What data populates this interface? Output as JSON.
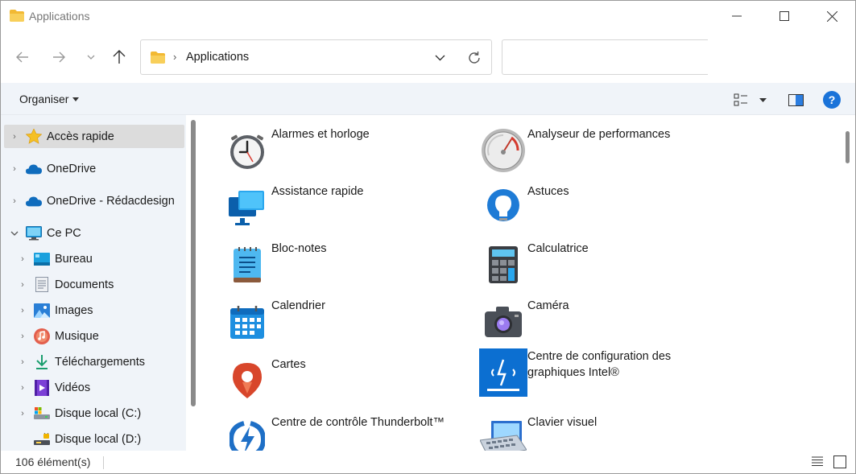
{
  "window": {
    "title": "Applications"
  },
  "address": {
    "path": "Applications",
    "search_placeholder": ""
  },
  "command_bar": {
    "organise_label": "Organiser",
    "help_label": "?"
  },
  "sidebar": {
    "items": [
      {
        "label": "Accès rapide",
        "icon": "star-icon",
        "expanded": false,
        "selected": true
      },
      {
        "label": "OneDrive",
        "icon": "cloud-icon",
        "expanded": false
      },
      {
        "label": "OneDrive - Rédacdesign",
        "icon": "cloud-icon",
        "expanded": false
      },
      {
        "label": "Ce PC",
        "icon": "monitor-icon",
        "expanded": true
      },
      {
        "label": "Bureau",
        "icon": "desktop-icon"
      },
      {
        "label": "Documents",
        "icon": "document-icon"
      },
      {
        "label": "Images",
        "icon": "pictures-icon"
      },
      {
        "label": "Musique",
        "icon": "music-icon"
      },
      {
        "label": "Téléchargements",
        "icon": "download-icon"
      },
      {
        "label": "Vidéos",
        "icon": "video-icon"
      },
      {
        "label": "Disque local (C:)",
        "icon": "drive-icon"
      },
      {
        "label": "Disque local (D:)",
        "icon": "drive-locked-icon"
      }
    ]
  },
  "apps": [
    {
      "label": "Alarmes et horloge",
      "icon": "clock-icon"
    },
    {
      "label": "Analyseur de performances",
      "icon": "gauge-icon"
    },
    {
      "label": "Assistance rapide",
      "icon": "quick-assist-icon"
    },
    {
      "label": "Astuces",
      "icon": "lightbulb-icon"
    },
    {
      "label": "Bloc-notes",
      "icon": "notepad-icon"
    },
    {
      "label": "Calculatrice",
      "icon": "calculator-icon"
    },
    {
      "label": "Calendrier",
      "icon": "calendar-icon"
    },
    {
      "label": "Caméra",
      "icon": "camera-icon"
    },
    {
      "label": "Cartes",
      "icon": "map-pin-icon"
    },
    {
      "label": "Centre de configuration des graphiques Intel®",
      "icon": "intel-graphics-icon"
    },
    {
      "label": "Centre de contrôle Thunderbolt™",
      "icon": "thunderbolt-icon"
    },
    {
      "label": "Clavier visuel",
      "icon": "keyboard-icon"
    }
  ],
  "status": {
    "item_count": "106 élément(s)"
  },
  "colors": {
    "accent": "#1a73d9",
    "sidebar_bg": "#f0f4f9",
    "selected_bg": "#dcdcdc",
    "folder_yellow": "#f5c242"
  }
}
